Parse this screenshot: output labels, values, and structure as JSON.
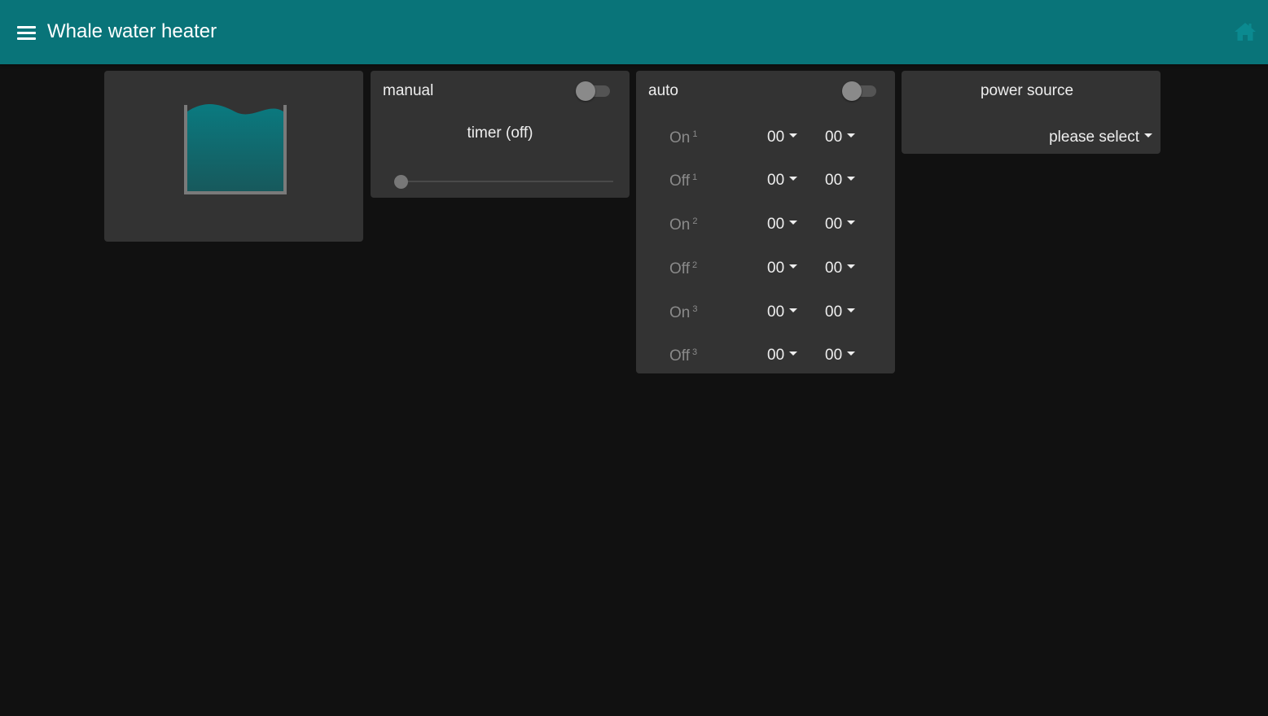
{
  "header": {
    "title": "Whale water heater",
    "bg_color": "#097479"
  },
  "tank": {
    "water_color": "#097479"
  },
  "manual": {
    "label": "manual",
    "toggle_on": false,
    "timer_label": "timer (off)",
    "slider_value": 0
  },
  "auto": {
    "label": "auto",
    "toggle_on": false,
    "rows": [
      {
        "label": "On",
        "index": "1",
        "hour": "00",
        "minute": "00"
      },
      {
        "label": "Off",
        "index": "1",
        "hour": "00",
        "minute": "00"
      },
      {
        "label": "On",
        "index": "2",
        "hour": "00",
        "minute": "00"
      },
      {
        "label": "Off",
        "index": "2",
        "hour": "00",
        "minute": "00"
      },
      {
        "label": "On",
        "index": "3",
        "hour": "00",
        "minute": "00"
      },
      {
        "label": "Off",
        "index": "3",
        "hour": "00",
        "minute": "00"
      }
    ]
  },
  "power": {
    "label": "power source",
    "selected": "please select"
  }
}
